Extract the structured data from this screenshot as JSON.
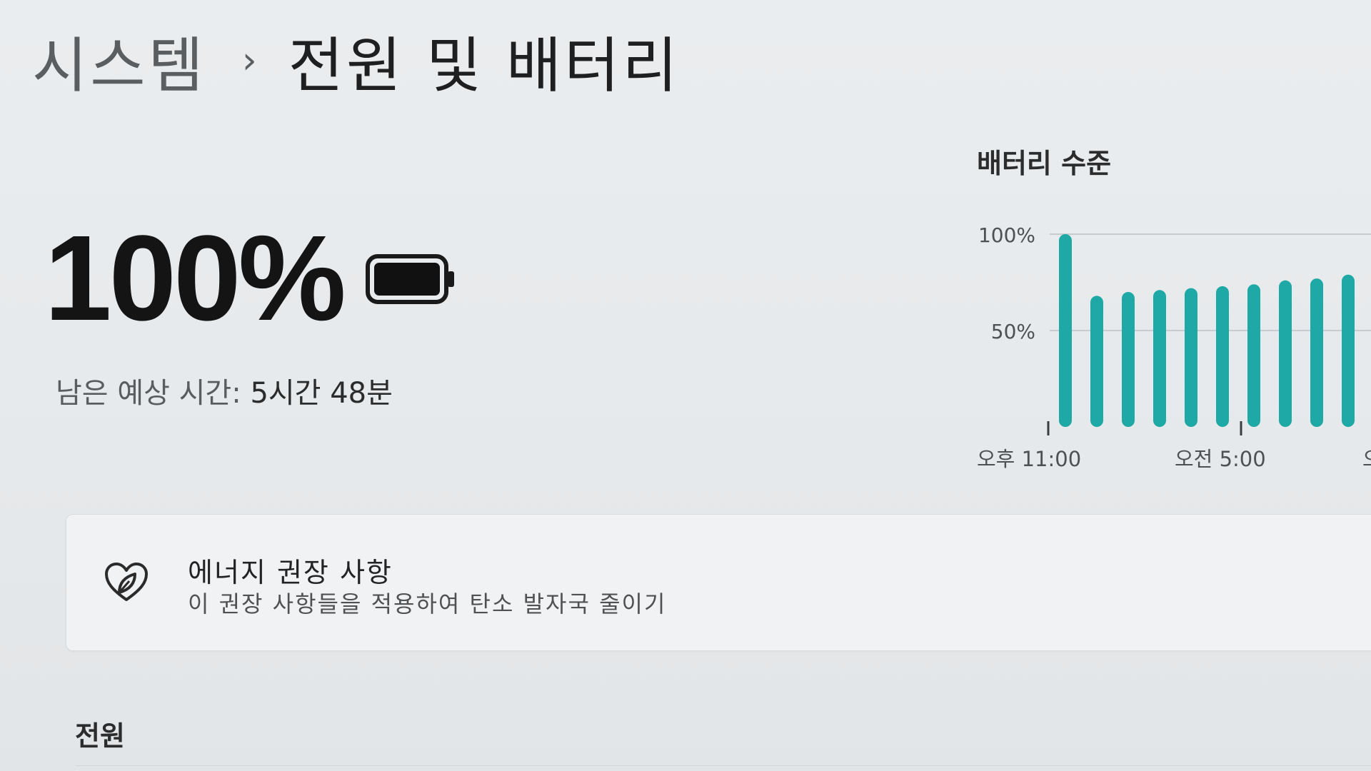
{
  "breadcrumb": {
    "parent": "시스템",
    "separator": "›",
    "current": "전원 및 배터리"
  },
  "battery": {
    "percent_text": "100%",
    "percent": 100,
    "remaining_label": "남은 예상 시간:",
    "remaining_value": "5시간 48분",
    "icon": "battery-full-icon"
  },
  "chart_data": {
    "type": "bar",
    "title": "배터리 수준",
    "y_tick_labels": [
      "100%",
      "50%"
    ],
    "x_tick_labels": [
      "오후 11:00",
      "오전 5:00",
      "오"
    ],
    "ylim": [
      0,
      100
    ],
    "grid": true,
    "series": [
      {
        "values": [
          100,
          68,
          70,
          71,
          72,
          73,
          74,
          76,
          77,
          79
        ]
      }
    ],
    "color": "#1fa9a6"
  },
  "energy_card": {
    "icon": "leaf-heart-icon",
    "title": "에너지 권장 사항",
    "subtitle": "이 권장 사항들을 적용하여 탄소 발자국 줄이기"
  },
  "power_section": {
    "title": "전원"
  }
}
